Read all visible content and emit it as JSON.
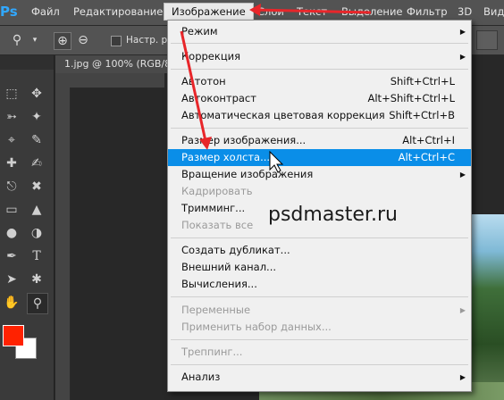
{
  "app": {
    "logo": "Ps"
  },
  "menubar": {
    "items": [
      "Файл",
      "Редактирование",
      "Изображение",
      "Слои",
      "Текст",
      "Выделение",
      "Фильтр",
      "3D",
      "Вид"
    ],
    "active": "Изображение"
  },
  "options": {
    "checkbox_label": "Настр. р"
  },
  "document": {
    "tab": "1.jpg @ 100% (RGB/8"
  },
  "tools": {
    "foreground_color": "#ff2200",
    "background_color": "#ffffff"
  },
  "menu": {
    "items": [
      {
        "label": "Режим",
        "shortcut": "",
        "submenu": true,
        "disabled": false
      },
      {
        "label": "Коррекция",
        "shortcut": "",
        "submenu": true,
        "disabled": false
      },
      {
        "label": "Автотон",
        "shortcut": "Shift+Ctrl+L",
        "submenu": false,
        "disabled": false
      },
      {
        "label": "Автоконтраст",
        "shortcut": "Alt+Shift+Ctrl+L",
        "submenu": false,
        "disabled": false
      },
      {
        "label": "Автоматическая цветовая коррекция",
        "shortcut": "Shift+Ctrl+B",
        "submenu": false,
        "disabled": false
      },
      {
        "label": "Размер изображения...",
        "shortcut": "Alt+Ctrl+I",
        "submenu": false,
        "disabled": false
      },
      {
        "label": "Размер холста...",
        "shortcut": "Alt+Ctrl+C",
        "submenu": false,
        "disabled": false,
        "highlighted": true
      },
      {
        "label": "Вращение изображения",
        "shortcut": "",
        "submenu": true,
        "disabled": false
      },
      {
        "label": "Кадрировать",
        "shortcut": "",
        "submenu": false,
        "disabled": true
      },
      {
        "label": "Тримминг...",
        "shortcut": "",
        "submenu": false,
        "disabled": false
      },
      {
        "label": "Показать все",
        "shortcut": "",
        "submenu": false,
        "disabled": true
      },
      {
        "label": "Создать дубликат...",
        "shortcut": "",
        "submenu": false,
        "disabled": false
      },
      {
        "label": "Внешний канал...",
        "shortcut": "",
        "submenu": false,
        "disabled": false
      },
      {
        "label": "Вычисления...",
        "shortcut": "",
        "submenu": false,
        "disabled": false
      },
      {
        "label": "Переменные",
        "shortcut": "",
        "submenu": true,
        "disabled": true
      },
      {
        "label": "Применить набор данных...",
        "shortcut": "",
        "submenu": false,
        "disabled": true
      },
      {
        "label": "Треппинг...",
        "shortcut": "",
        "submenu": false,
        "disabled": true
      },
      {
        "label": "Анализ",
        "shortcut": "",
        "submenu": true,
        "disabled": false
      }
    ]
  },
  "watermark": "psdmaster.ru",
  "annotation_color": "#e8262a"
}
